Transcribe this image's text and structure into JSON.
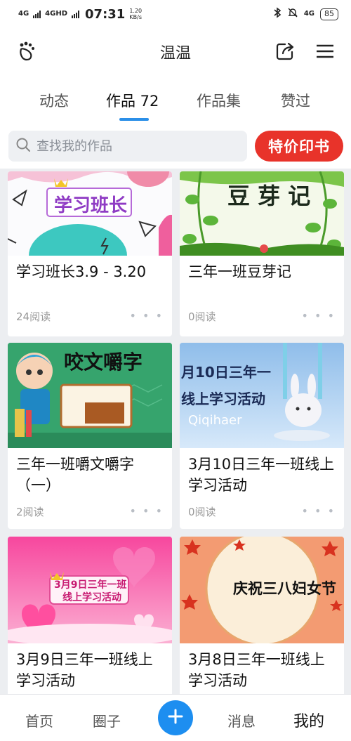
{
  "status_bar": {
    "sim1": "4G",
    "sim2": "4GHD",
    "time": "07:31",
    "speed_value": "1.20",
    "speed_unit": "KB/s",
    "net": "4G",
    "battery": "85"
  },
  "header": {
    "title": "温温"
  },
  "tabs": [
    {
      "label": "动态"
    },
    {
      "label": "作品 72"
    },
    {
      "label": "作品集"
    },
    {
      "label": "赞过"
    }
  ],
  "search": {
    "placeholder": "查找我的作品",
    "promo_label": "特价印书"
  },
  "works": [
    {
      "title": "学习班长3.9 - 3.20",
      "reads": "24阅读",
      "cover_text": "学习班长",
      "more": "• • •"
    },
    {
      "title": "三年一班豆芽记",
      "reads": "0阅读",
      "cover_text": "豆 芽 记",
      "more": "• • •"
    },
    {
      "title": "三年一班嚼文嚼字（一）",
      "reads": "2阅读",
      "cover_text": "咬文嚼字",
      "more": "• • •"
    },
    {
      "title": "3月10日三年一班线上学习活动",
      "reads": "0阅读",
      "cover_text_1": "月10日三年一",
      "cover_text_2": "线上学习活动",
      "cover_text_3": "Qiqihaer",
      "more": "• • •"
    },
    {
      "title": "3月9日三年一班线上学习活动",
      "reads": "",
      "cover_text_1": "3月9日三年一班",
      "cover_text_2": "线上学习活动",
      "more": ""
    },
    {
      "title": "3月8日三年一班线上学习活动",
      "reads": "",
      "cover_text": "庆祝三八妇女节",
      "more": ""
    }
  ],
  "bottom_nav": {
    "home": "首页",
    "circle": "圈子",
    "messages": "消息",
    "me": "我的"
  },
  "colors": {
    "accent": "#2b8fe8",
    "promo": "#e8332a",
    "fab": "#1d8ef0"
  }
}
